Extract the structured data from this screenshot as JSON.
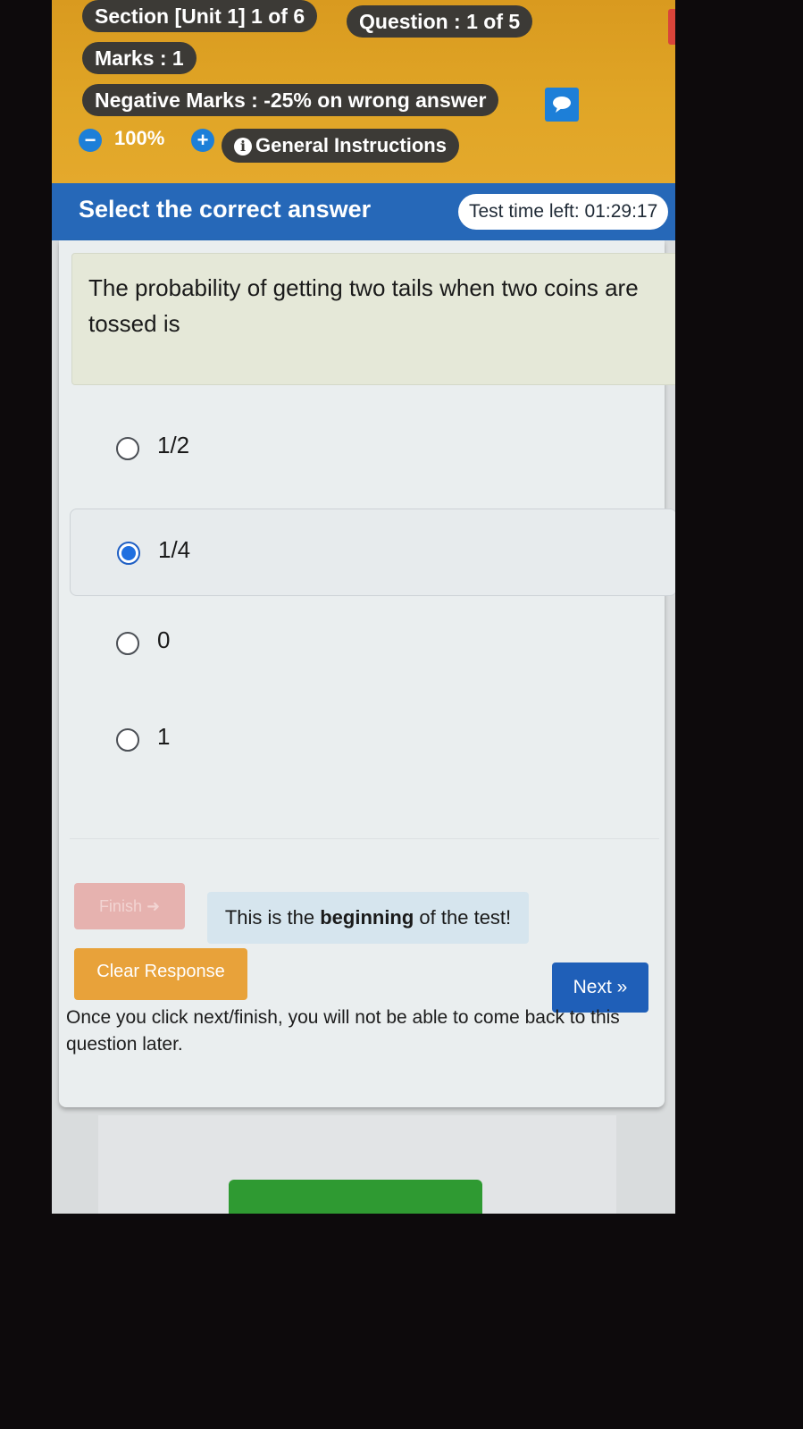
{
  "header": {
    "section_label": "Section [Unit 1] 1 of 6",
    "question_counter": "Question : 1 of 5",
    "marks": "Marks : 1",
    "negative_marks": "Negative Marks : -25% on wrong answer",
    "close_icon": "close-icon",
    "chat_icon": "chat-icon",
    "zoom_out_symbol": "−",
    "zoom_level": "100%",
    "zoom_in_symbol": "+",
    "info_icon_glyph": "i",
    "general_instructions": "General Instructions"
  },
  "subheader": {
    "instruction": "Select the correct answer",
    "timer": "Test time left: 01:29:17"
  },
  "question": {
    "text": "The probability of getting two tails when two coins are tossed is",
    "options": [
      {
        "label": "1/2",
        "selected": false
      },
      {
        "label": "1/4",
        "selected": true
      },
      {
        "label": "0",
        "selected": false
      },
      {
        "label": "1",
        "selected": false
      }
    ]
  },
  "footer": {
    "finish_label": "Finish",
    "finish_icon": "sign-out-icon",
    "beginning_prefix": "This is the ",
    "beginning_bold": "beginning",
    "beginning_suffix": " of the test!",
    "clear_response_label": "Clear Response",
    "next_label": "Next »",
    "warning": "Once you click next/finish, you will not be able to come back to this question later."
  },
  "colors": {
    "header_bg": "#e0a526",
    "subheader_bg": "#2668b8",
    "pill_bg": "#3c3a36",
    "close_bg": "#d9443a",
    "accent_blue": "#1d7fd8",
    "clear_bg": "#e8a23a",
    "next_bg": "#1f5fb8"
  }
}
